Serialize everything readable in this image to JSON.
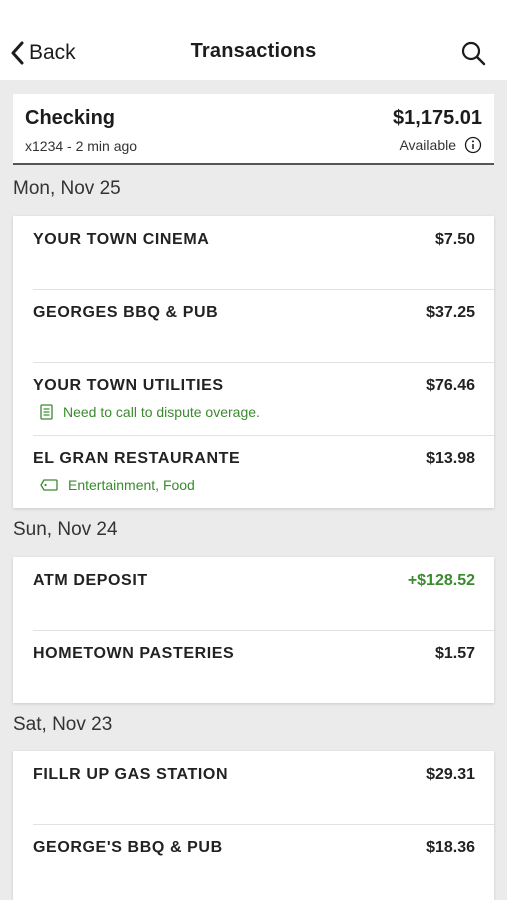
{
  "header": {
    "back_label": "Back",
    "title": "Transactions"
  },
  "account": {
    "name": "Checking",
    "sub": "x1234 - 2 min ago",
    "balance": "$1,175.01",
    "available_label": "Available"
  },
  "groups": [
    {
      "date": "Mon, Nov 25",
      "transactions": [
        {
          "name": "YOUR TOWN CINEMA",
          "amount": "$7.50"
        },
        {
          "name": "GEORGES BBQ & PUB",
          "amount": "$37.25"
        },
        {
          "name": "YOUR TOWN UTILITIES",
          "amount": "$76.46",
          "note": "Need to call to dispute overage.",
          "note_icon": "note-icon"
        },
        {
          "name": "EL GRAN RESTAURANTE",
          "amount": "$13.98",
          "note": "Entertainment, Food",
          "note_icon": "tag-icon"
        }
      ]
    },
    {
      "date": "Sun, Nov 24",
      "transactions": [
        {
          "name": "ATM DEPOSIT",
          "amount": "+$128.52",
          "credit": true
        },
        {
          "name": "HOMETOWN PASTERIES",
          "amount": "$1.57"
        }
      ]
    },
    {
      "date": "Sat, Nov 23",
      "transactions": [
        {
          "name": "FILLR UP GAS STATION",
          "amount": "$29.31"
        },
        {
          "name": "GEORGE'S BBQ & PUB",
          "amount": "$18.36"
        }
      ]
    }
  ],
  "colors": {
    "credit": "#3a8a2e",
    "background": "#ebebeb"
  }
}
